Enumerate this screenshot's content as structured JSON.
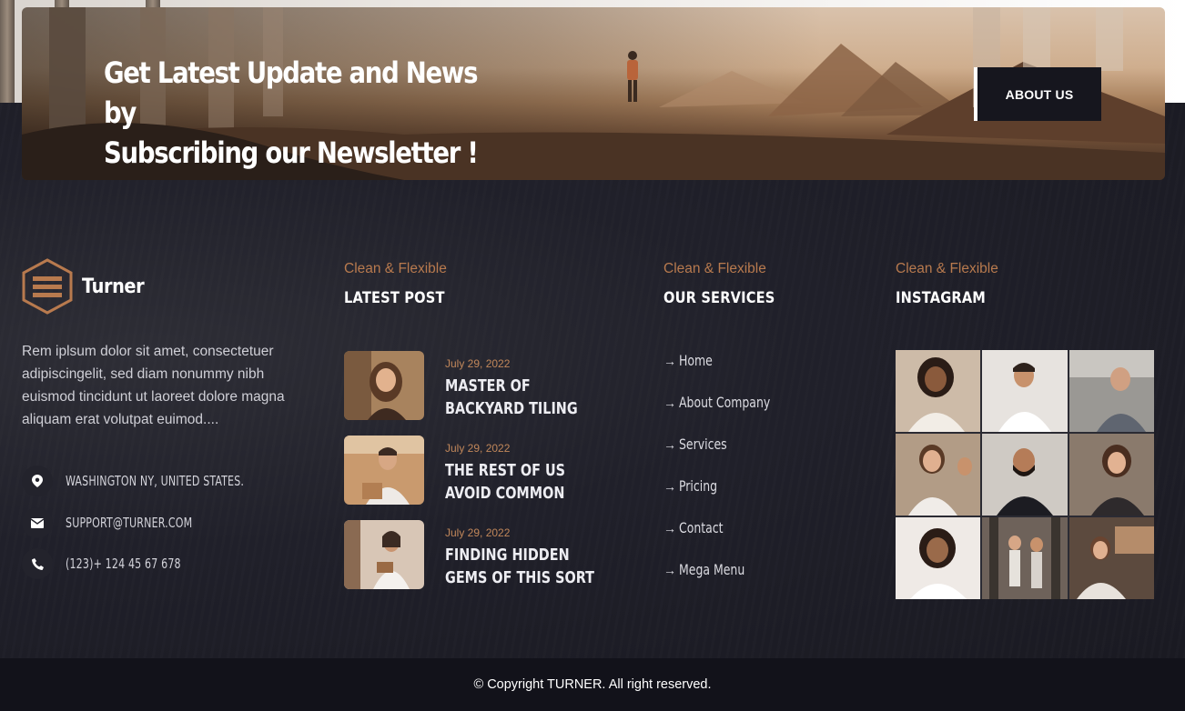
{
  "newsletter": {
    "title_line1": "Get Latest Update and News by",
    "title_line2": "Subscribing our Newsletter !",
    "button_label": "ABOUT US"
  },
  "brand": {
    "name": "Turner",
    "logo_icon": "hexagon-logo-icon",
    "accent_color": "#b87a4e"
  },
  "about": {
    "text": "Rem iplsum dolor sit amet, consectetuer adipiscingelit, sed diam nonummy nibh euismod tincidunt ut laoreet dolore magna aliquam erat volutpat euimod...."
  },
  "contact": [
    {
      "icon": "location-pin-icon",
      "text": "WASHINGTON NY, UNITED STATES."
    },
    {
      "icon": "envelope-icon",
      "text": "SUPPORT@TURNER.COM"
    },
    {
      "icon": "phone-icon",
      "text": "(123)+ 124 45 67 678"
    }
  ],
  "latest_post": {
    "subtitle": "Clean & Flexible",
    "heading": "LATEST POST",
    "posts": [
      {
        "date": "July 29, 2022",
        "title": "MASTER OF BACKYARD TILING"
      },
      {
        "date": "July 29, 2022",
        "title": "THE REST OF US AVOID COMMON"
      },
      {
        "date": "July 29, 2022",
        "title": "FINDING HIDDEN GEMS OF THIS SORT"
      }
    ]
  },
  "services": {
    "subtitle": "Clean & Flexible",
    "heading": "OUR SERVICES",
    "arrow_icon": "arrow-right-icon",
    "items": [
      {
        "label": "Home"
      },
      {
        "label": "About Company"
      },
      {
        "label": "Services"
      },
      {
        "label": "Pricing"
      },
      {
        "label": "Contact"
      },
      {
        "label": "Mega Menu"
      }
    ]
  },
  "instagram": {
    "subtitle": "Clean & Flexible",
    "heading": "INSTAGRAM"
  },
  "footer": {
    "copyright": "© Copyright TURNER. All right reserved."
  }
}
